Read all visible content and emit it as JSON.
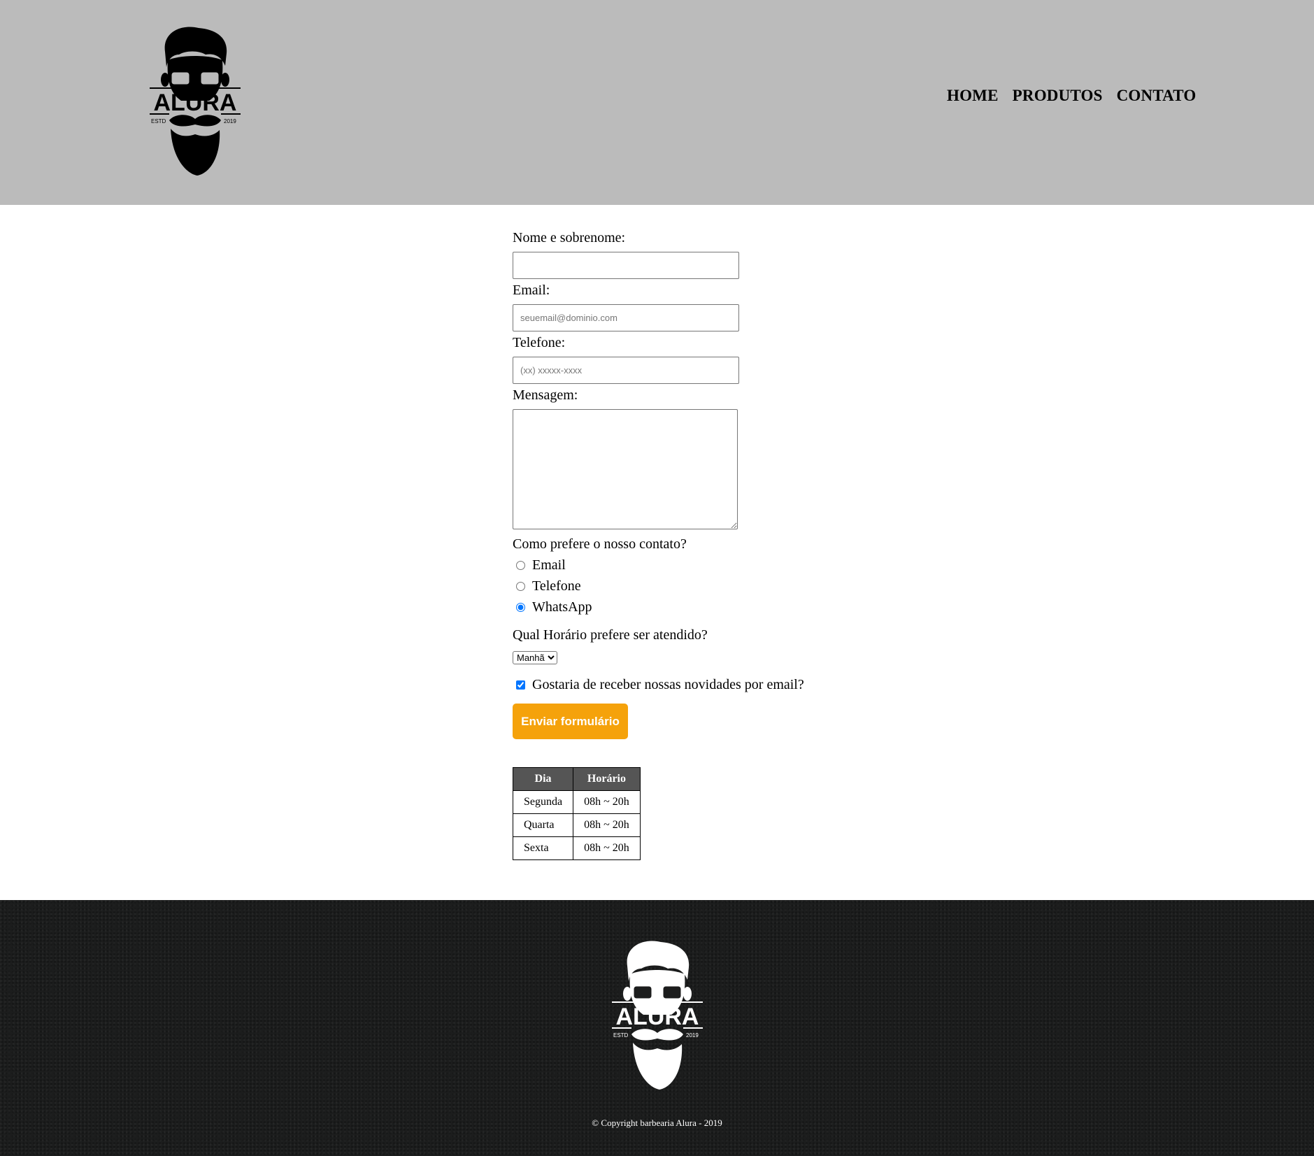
{
  "header": {
    "logo": {
      "icon": "alura-barber-logo",
      "text": "ALURA",
      "estd": "ESTD",
      "year": "2019"
    },
    "nav": [
      {
        "label": "HOME"
      },
      {
        "label": "PRODUTOS"
      },
      {
        "label": "CONTATO"
      }
    ]
  },
  "form": {
    "name_label": "Nome e sobrenome:",
    "name_value": "",
    "email_label": "Email:",
    "email_placeholder": "seuemail@dominio.com",
    "phone_label": "Telefone:",
    "phone_placeholder": "(xx) xxxxx-xxxx",
    "message_label": "Mensagem:",
    "message_value": "",
    "contact_question": "Como prefere o nosso contato?",
    "contact_options": [
      {
        "label": "Email",
        "checked": false
      },
      {
        "label": "Telefone",
        "checked": false
      },
      {
        "label": "WhatsApp",
        "checked": true
      }
    ],
    "time_question": "Qual Horário prefere ser atendido?",
    "time_selected": "Manhã",
    "newsletter_label": "Gostaria de receber nossas novidades por email?",
    "newsletter_checked": true,
    "submit_label": "Enviar formulário"
  },
  "schedule": {
    "headers": [
      "Dia",
      "Horário"
    ],
    "rows": [
      [
        "Segunda",
        "08h ~ 20h"
      ],
      [
        "Quarta",
        "08h ~ 20h"
      ],
      [
        "Sexta",
        "08h ~ 20h"
      ]
    ]
  },
  "footer": {
    "copyright": "© Copyright barbearia Alura - 2019"
  },
  "colors": {
    "header_bg": "#bbbbbb",
    "footer_bg": "#1c1d1d",
    "button_bg": "#f5a20b",
    "table_header_bg": "#555555"
  }
}
